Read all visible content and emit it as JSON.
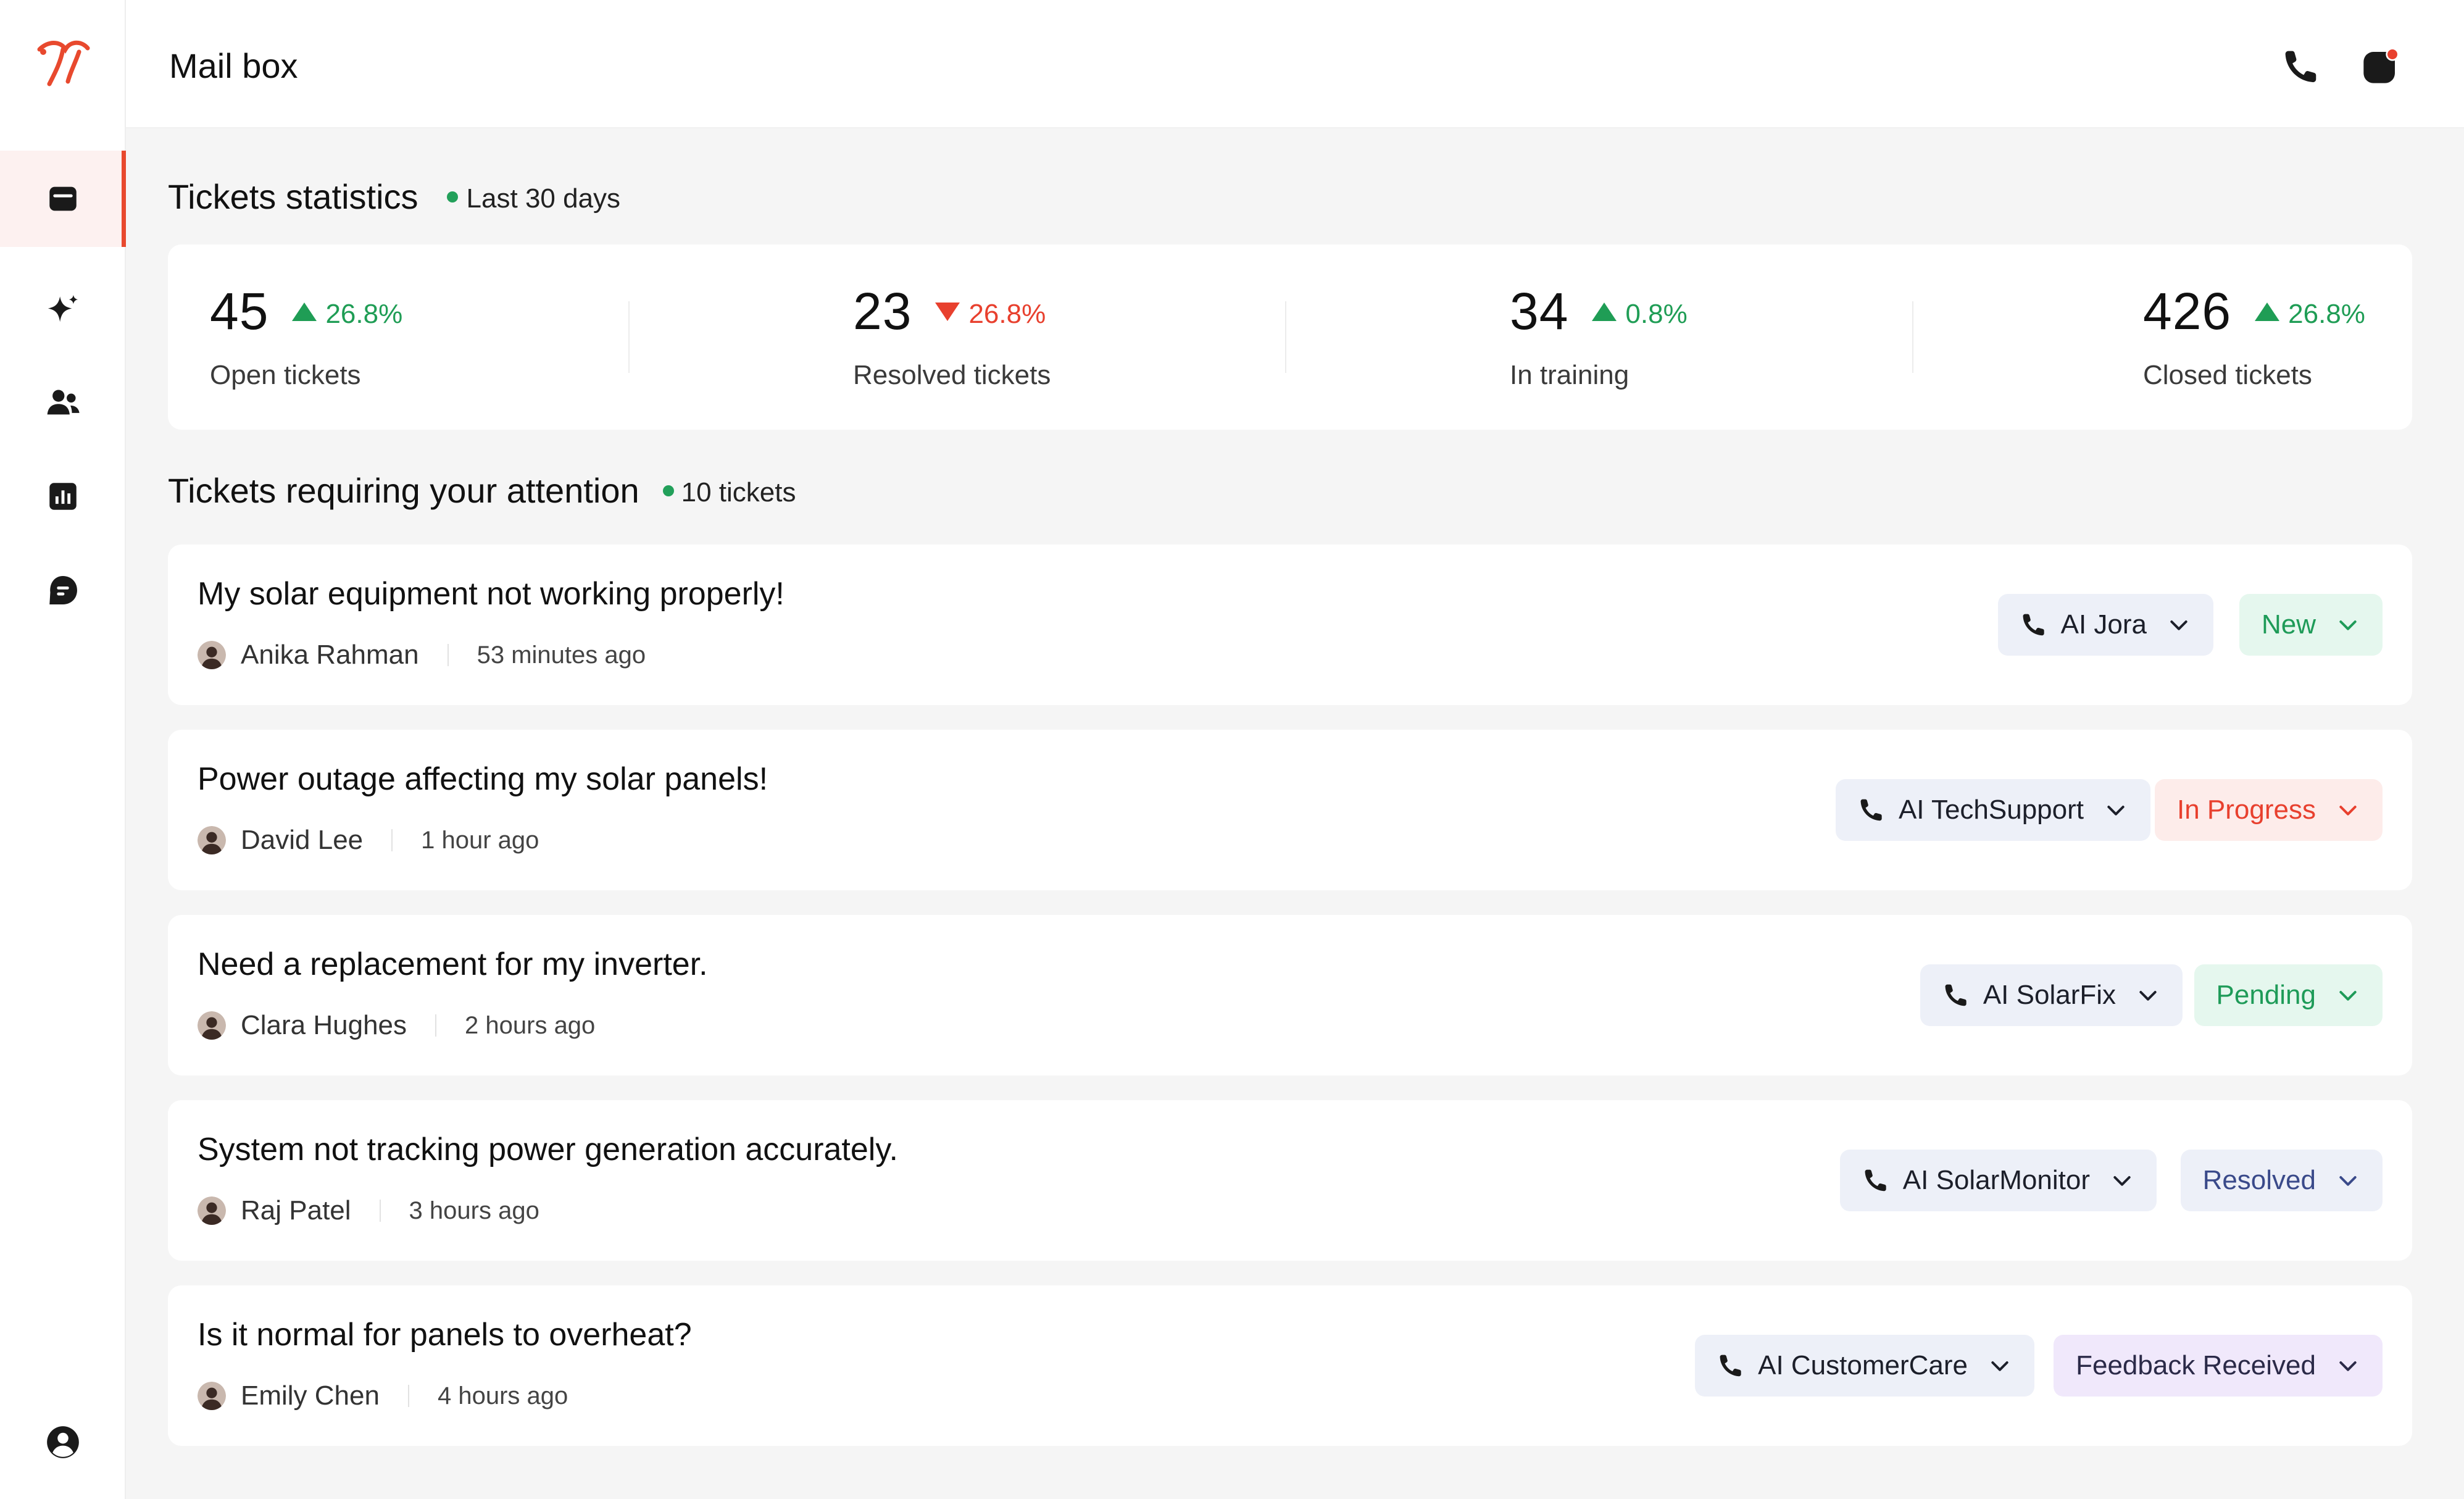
{
  "header": {
    "title": "Mail box"
  },
  "stats_section": {
    "title": "Tickets statistics",
    "period": "Last 30 days"
  },
  "stats": [
    {
      "value": "45",
      "change": "26.8%",
      "direction": "up",
      "label": "Open tickets"
    },
    {
      "value": "23",
      "change": "26.8%",
      "direction": "down",
      "label": "Resolved tickets"
    },
    {
      "value": "34",
      "change": "0.8%",
      "direction": "up",
      "label": "In training"
    },
    {
      "value": "426",
      "change": "26.8%",
      "direction": "up",
      "label": "Closed tickets"
    }
  ],
  "attention_section": {
    "title": "Tickets requiring your attention",
    "count": "10 tickets"
  },
  "tickets": [
    {
      "title": "My solar equipment not working properly!",
      "author": "Anika Rahman",
      "time": "53 minutes ago",
      "agent": "AI Jora",
      "status": "New"
    },
    {
      "title": "Power outage affecting my solar panels!",
      "author": "David Lee",
      "time": "1 hour ago",
      "agent": "AI TechSupport",
      "status": "In Progress"
    },
    {
      "title": "Need a replacement for my inverter.",
      "author": "Clara Hughes",
      "time": "2 hours ago",
      "agent": "AI SolarFix",
      "status": "Pending"
    },
    {
      "title": "System not tracking power generation accurately.",
      "author": "Raj Patel",
      "time": "3 hours ago",
      "agent": "AI SolarMonitor",
      "status": "Resolved"
    },
    {
      "title": "Is it normal for panels to overheat?",
      "author": "Emily Chen",
      "time": "4 hours ago",
      "agent": "AI CustomerCare",
      "status": "Feedback Received"
    }
  ],
  "icons": {
    "logo": "brand-logo-icon",
    "nav": [
      "inbox-icon",
      "sparkle-icon",
      "users-icon",
      "analytics-icon",
      "chat-icon"
    ],
    "footer": "user-profile-icon",
    "header": [
      "phone-icon",
      "notification-icon"
    ]
  },
  "colors": {
    "accent": "#e8492e",
    "positive": "#1f9d55",
    "negative": "#e8402e"
  }
}
